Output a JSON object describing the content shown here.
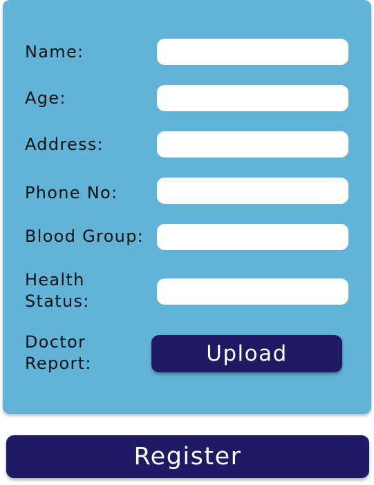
{
  "form": {
    "fields": [
      {
        "label": "Name:",
        "value": ""
      },
      {
        "label": "Age:",
        "value": ""
      },
      {
        "label": "Address:",
        "value": ""
      },
      {
        "label": "Phone No:",
        "value": ""
      },
      {
        "label": "Blood Group:",
        "value": ""
      },
      {
        "label_line1": "Health",
        "label_line2": "Status:",
        "value": ""
      }
    ],
    "doctor_report": {
      "label_line1": "Doctor",
      "label_line2": "Report:",
      "button_label": "Upload"
    }
  },
  "register_button_label": "Register",
  "colors": {
    "card_background": "#62b3d8",
    "button_background": "#1f1a63",
    "field_background": "#ffffff",
    "text": "#111111"
  }
}
